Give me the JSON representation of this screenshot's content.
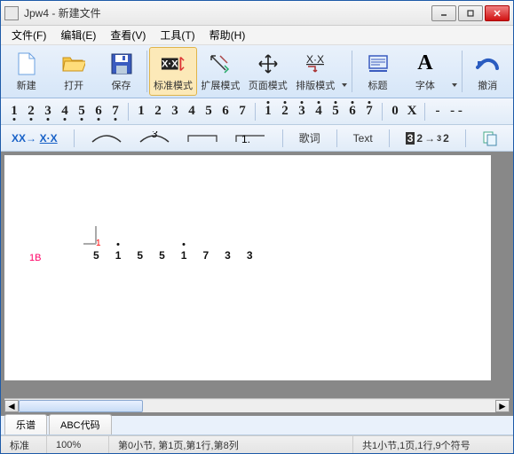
{
  "window": {
    "title": "Jpw4 - 新建文件"
  },
  "menu": {
    "file": "文件(F)",
    "edit": "编辑(E)",
    "view": "查看(V)",
    "tools": "工具(T)",
    "help": "帮助(H)"
  },
  "ribbon": {
    "new": "新建",
    "open": "打开",
    "save": "保存",
    "standard": "标准模式",
    "extend": "扩展模式",
    "page": "页面模式",
    "layout": "排版模式",
    "title": "标题",
    "font": "字体",
    "undo": "撤消"
  },
  "toolbar3": {
    "xx": "XX→",
    "xdot": "X·X",
    "lyric": "歌词",
    "text": "Text"
  },
  "notation": {
    "marker": "1B",
    "red": "1",
    "notes": [
      "5",
      "1",
      "5",
      "5",
      "1",
      "7",
      "3",
      "3"
    ],
    "dotted": [
      false,
      true,
      false,
      false,
      true,
      false,
      false,
      false
    ]
  },
  "tabs": {
    "score": "乐谱",
    "abc": "ABC代码"
  },
  "status": {
    "mode": "标准",
    "zoom": "100%",
    "pos": "第0小节, 第1页,第1行,第8列",
    "summary": "共1小节,1页,1行,9个符号"
  }
}
